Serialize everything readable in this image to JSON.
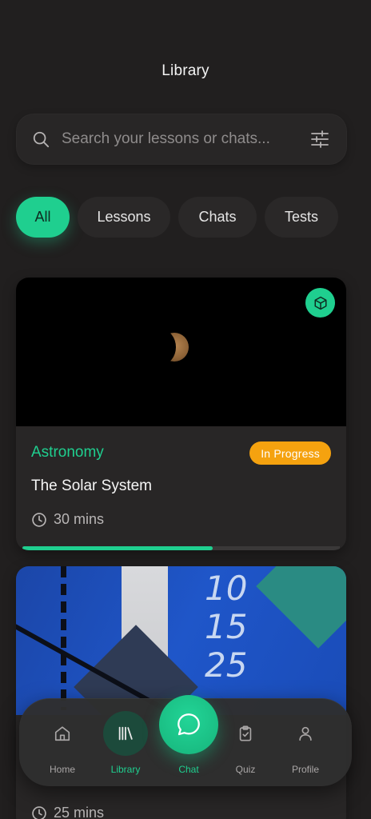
{
  "header": {
    "title": "Library"
  },
  "search": {
    "placeholder": "Search your lessons or chats..."
  },
  "filters": [
    {
      "label": "All",
      "active": true
    },
    {
      "label": "Lessons",
      "active": false
    },
    {
      "label": "Chats",
      "active": false
    },
    {
      "label": "Tests",
      "active": false
    }
  ],
  "cards": [
    {
      "subject": "Astronomy",
      "status": "In Progress",
      "title": "The Solar System",
      "duration": "30 mins",
      "progress": 0.6,
      "type_icon": "cube-icon"
    },
    {
      "handwriting": [
        "10",
        "15",
        "25"
      ],
      "duration": "25 mins"
    }
  ],
  "nav": {
    "items": [
      {
        "label": "Home",
        "icon": "home-icon"
      },
      {
        "label": "Library",
        "icon": "library-icon",
        "active": true
      },
      {
        "label": "Chat",
        "icon": "chat-icon"
      },
      {
        "label": "Quiz",
        "icon": "clipboard-check-icon"
      },
      {
        "label": "Profile",
        "icon": "user-icon"
      }
    ]
  },
  "colors": {
    "background": "#211f1f",
    "accent": "#1fcf8f",
    "status_orange": "#f5a20f",
    "card": "#282626"
  }
}
